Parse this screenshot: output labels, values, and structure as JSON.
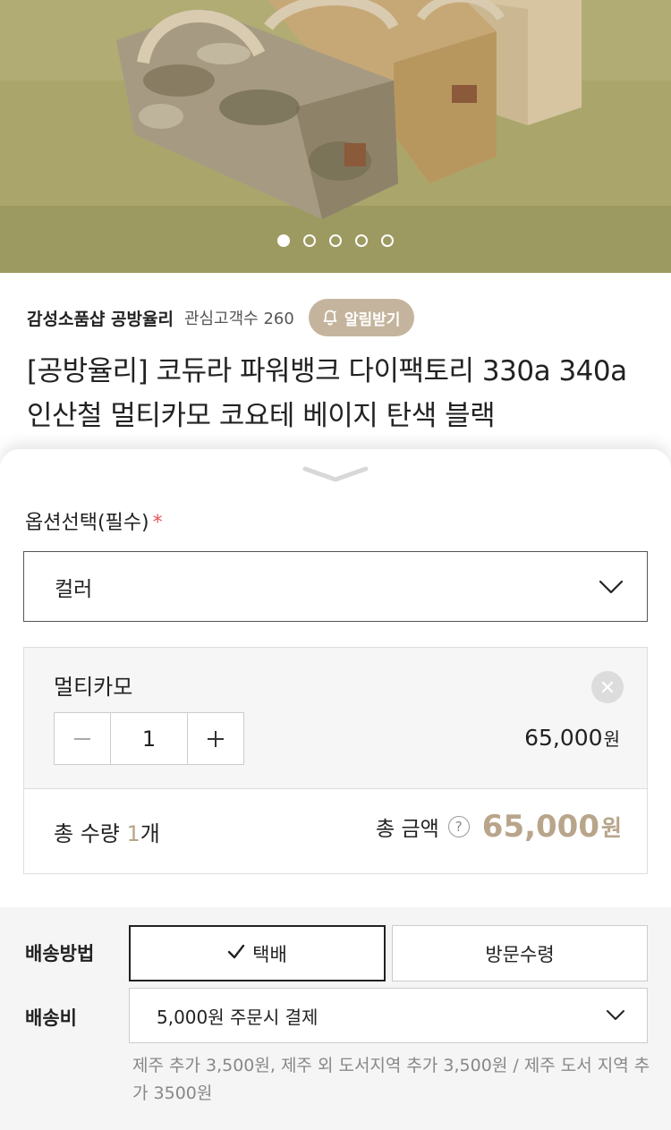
{
  "photo": {
    "dots_total": 5,
    "active_dot": 0
  },
  "seller": {
    "name": "감성소품샵 공방율리",
    "followers": "관심고객수 260",
    "notify_button": "알림받기"
  },
  "product": {
    "title": "[공방율리] 코듀라 파워뱅크 다이팩토리 330a 340a 인산철 멀티카모 코요테 베이지 탄색 블랙"
  },
  "options": {
    "label": "옵션선택(필수)",
    "required_mark": "*",
    "select_value": "컬러"
  },
  "selected_item": {
    "name": "멀티카모",
    "quantity": "1",
    "price": "65,000",
    "currency": "원"
  },
  "totals": {
    "qty_label": "총 수량",
    "qty_value": "1",
    "qty_unit": "개",
    "amount_label": "총 금액",
    "help": "?",
    "amount_value": "65,000",
    "currency": "원"
  },
  "shipping": {
    "method_label": "배송방법",
    "method_selected": "택배",
    "method_other": "방문수령",
    "fee_label": "배송비",
    "fee_value": "5,000원 주문시 결제",
    "fee_note": "제주 추가 3,500원, 제주 외 도서지역 추가 3,500원 / 제주 도서 지역 추가 3500원"
  },
  "colors": {
    "accent": "#b8a58a",
    "notify_bg": "#c5b49d",
    "required": "#e35757"
  }
}
